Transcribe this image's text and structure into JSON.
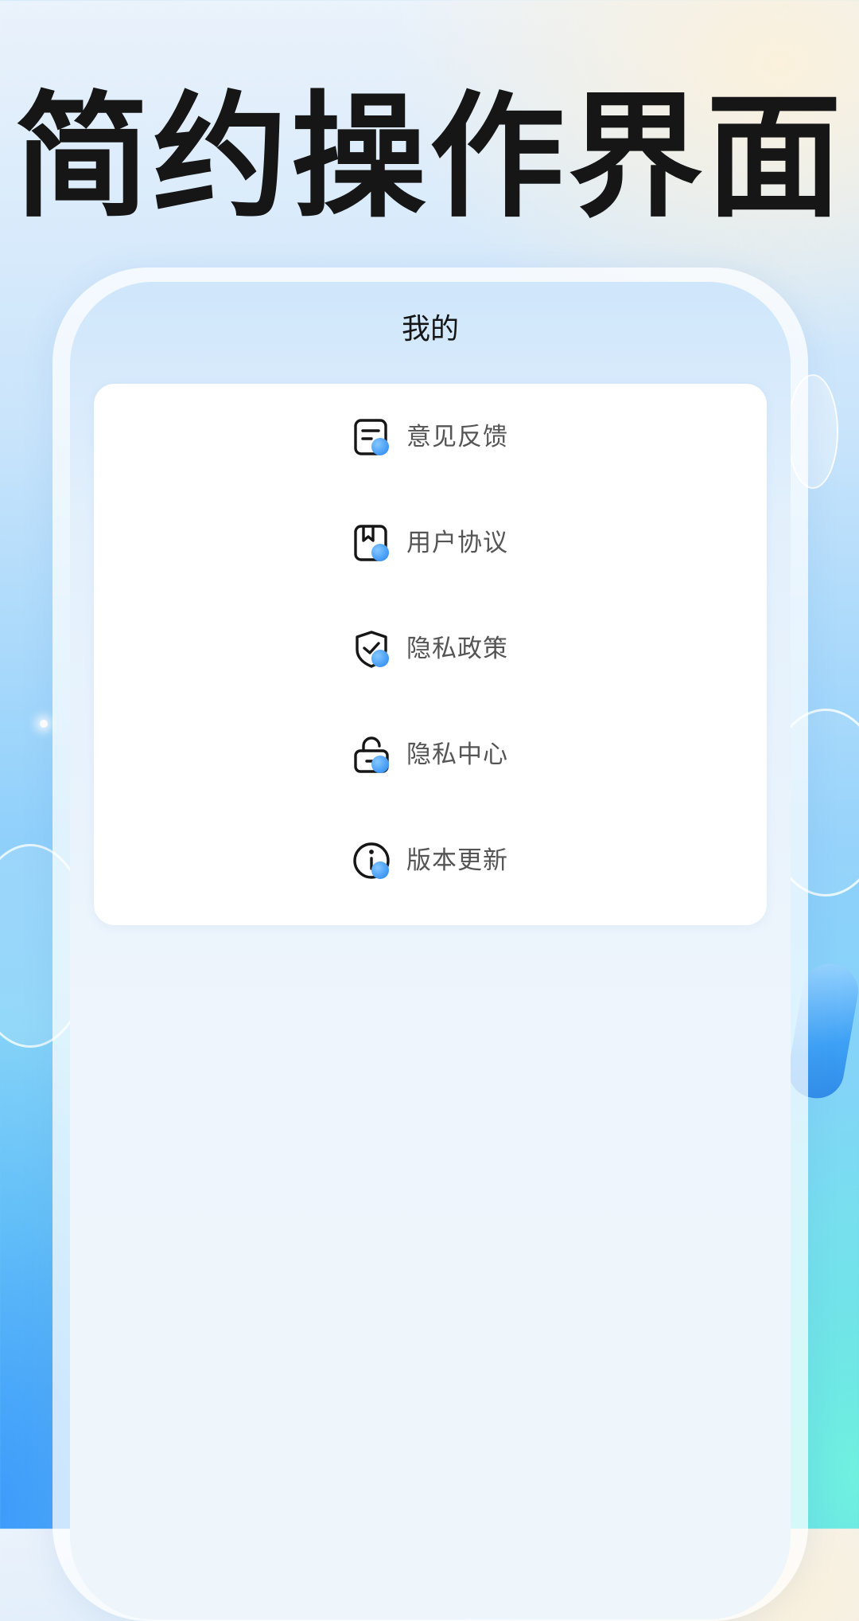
{
  "headline": "简约操作界面",
  "screen": {
    "title": "我的"
  },
  "menu": {
    "items": [
      {
        "label": "意见反馈",
        "icon": "feedback-note-icon"
      },
      {
        "label": "用户协议",
        "icon": "bookmark-document-icon"
      },
      {
        "label": "隐私政策",
        "icon": "shield-check-icon"
      },
      {
        "label": "隐私中心",
        "icon": "padlock-icon"
      },
      {
        "label": "版本更新",
        "icon": "info-icon"
      }
    ]
  },
  "colors": {
    "icon_accent": "#3f97f5",
    "headline": "#161616",
    "label": "#555555"
  }
}
